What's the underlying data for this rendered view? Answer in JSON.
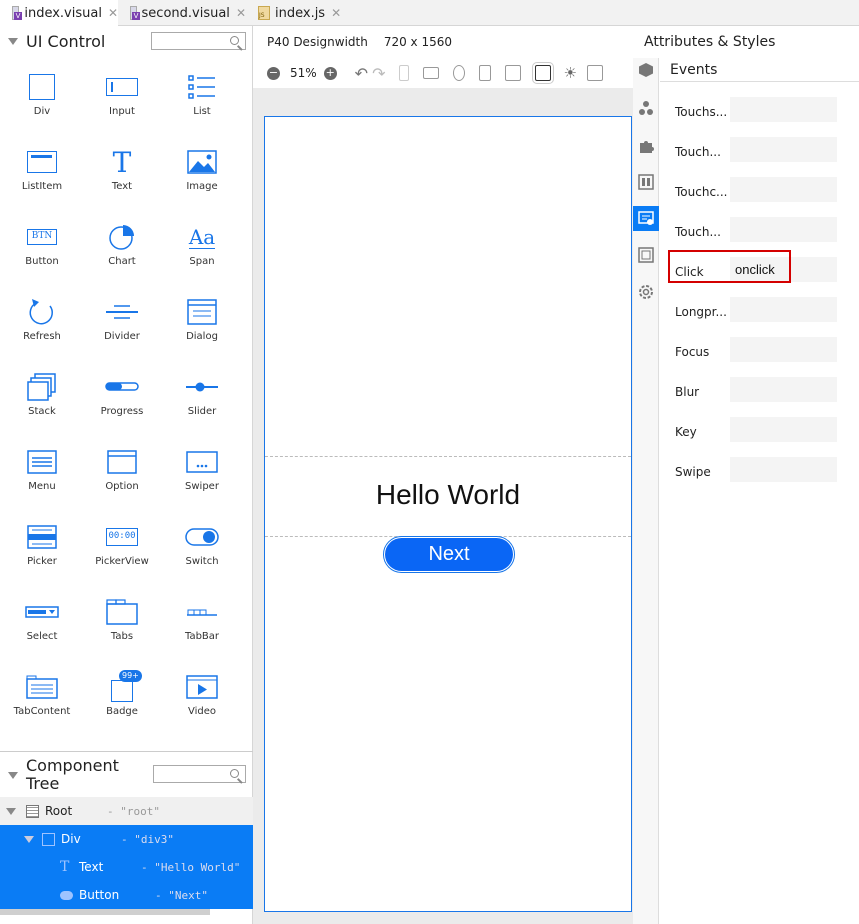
{
  "tabs": [
    {
      "label": "index.visual",
      "icon": "visual-file-icon",
      "active": true
    },
    {
      "label": "second.visual",
      "icon": "visual-file-icon",
      "active": false
    },
    {
      "label": "index.js",
      "icon": "js-file-icon",
      "active": false
    }
  ],
  "left": {
    "ui_control_title": "UI Control",
    "controls": [
      {
        "label": "Div",
        "icon": "div-icon"
      },
      {
        "label": "Input",
        "icon": "input-icon"
      },
      {
        "label": "List",
        "icon": "list-icon"
      },
      {
        "label": "ListItem",
        "icon": "listitem-icon"
      },
      {
        "label": "Text",
        "icon": "text-icon"
      },
      {
        "label": "Image",
        "icon": "image-icon"
      },
      {
        "label": "Button",
        "icon": "button-icon"
      },
      {
        "label": "Chart",
        "icon": "chart-icon"
      },
      {
        "label": "Span",
        "icon": "span-icon"
      },
      {
        "label": "Refresh",
        "icon": "refresh-icon"
      },
      {
        "label": "Divider",
        "icon": "divider-icon"
      },
      {
        "label": "Dialog",
        "icon": "dialog-icon"
      },
      {
        "label": "Stack",
        "icon": "stack-icon"
      },
      {
        "label": "Progress",
        "icon": "progress-icon"
      },
      {
        "label": "Slider",
        "icon": "slider-icon"
      },
      {
        "label": "Menu",
        "icon": "menu-icon"
      },
      {
        "label": "Option",
        "icon": "option-icon"
      },
      {
        "label": "Swiper",
        "icon": "swiper-icon"
      },
      {
        "label": "Picker",
        "icon": "picker-icon"
      },
      {
        "label": "PickerView",
        "icon": "pickerview-icon"
      },
      {
        "label": "Switch",
        "icon": "switch-icon"
      },
      {
        "label": "Select",
        "icon": "select-icon"
      },
      {
        "label": "Tabs",
        "icon": "tabs-icon"
      },
      {
        "label": "TabBar",
        "icon": "tabbar-icon"
      },
      {
        "label": "TabContent",
        "icon": "tabcontent-icon"
      },
      {
        "label": "Badge",
        "icon": "badge-icon"
      },
      {
        "label": "Video",
        "icon": "video-icon"
      }
    ],
    "btn_icon_text": "BTN",
    "text_icon_text": "T",
    "span_icon_text": "Aa",
    "pickerview_icon_text": "00:00",
    "badge_icon_text": "99+",
    "component_tree_title": "Component Tree",
    "tree": [
      {
        "name": "Root",
        "id": "- \"root\"",
        "icon": "root-icon"
      },
      {
        "name": "Div",
        "id": "- \"div3\"",
        "icon": "div-icon"
      },
      {
        "name": "Text",
        "id": "- \"Hello World\"",
        "icon": "text-icon"
      },
      {
        "name": "Button",
        "id": "- \"Next\"",
        "icon": "button-icon"
      }
    ]
  },
  "center": {
    "device": "P40 Designwidth",
    "resolution": "720 x 1560",
    "zoom": "51%",
    "zoom_out": "−",
    "zoom_in": "+",
    "canvas": {
      "hello_text": "Hello World",
      "next_label": "Next"
    }
  },
  "right": {
    "title": "Attributes & Styles",
    "events_title": "Events",
    "events": [
      {
        "label": "Touchs...",
        "value": ""
      },
      {
        "label": "Touch...",
        "value": ""
      },
      {
        "label": "Touchc...",
        "value": ""
      },
      {
        "label": "Touch...",
        "value": ""
      },
      {
        "label": "Click",
        "value": "onclick"
      },
      {
        "label": "Longpr...",
        "value": ""
      },
      {
        "label": "Focus",
        "value": ""
      },
      {
        "label": "Blur",
        "value": ""
      },
      {
        "label": "Key",
        "value": ""
      },
      {
        "label": "Swipe",
        "value": ""
      }
    ]
  },
  "colors": {
    "accent": "#1976e8",
    "selection": "#0a7cf5",
    "button": "#0a66f5",
    "highlight": "#d40000"
  }
}
